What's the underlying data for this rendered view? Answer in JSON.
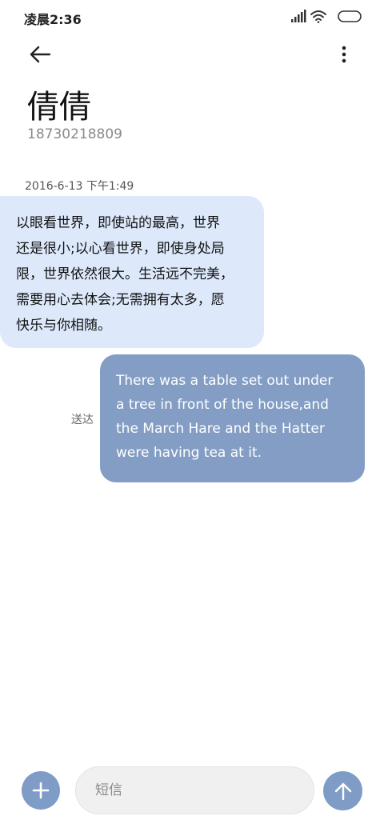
{
  "status_bar": {
    "time": "凌晨2:36",
    "icons": [
      "signal-icon",
      "wifi-icon",
      "battery-icon"
    ]
  },
  "header": {
    "back_icon": "back-arrow-icon",
    "more_icon": "more-vertical-icon"
  },
  "contact": {
    "name": "倩倩",
    "number": "18730218809"
  },
  "conversation": {
    "date": "2016-6-13 下午1:49",
    "incoming": {
      "lines": [
        "以眼看世界，即使站的最高，世界",
        "还是很小;以心看世界，即使身处局",
        "限，世界依然很大。生活远不完美，",
        "需要用心去体会;无需拥有太多，愿",
        "快乐与你相随。"
      ]
    },
    "outgoing": {
      "lines": [
        "There was a table set out under",
        "a tree in front of the house,and",
        "the March Hare and the Hatter",
        "were having tea at it."
      ],
      "status": "送达"
    }
  },
  "composer": {
    "add_icon": "plus-icon",
    "placeholder": "短信",
    "send_icon": "arrow-up-icon"
  },
  "colors": {
    "incoming_bubble": "#dde9fb",
    "outgoing_bubble": "#839dc4",
    "accent": "#7f9cc6"
  }
}
